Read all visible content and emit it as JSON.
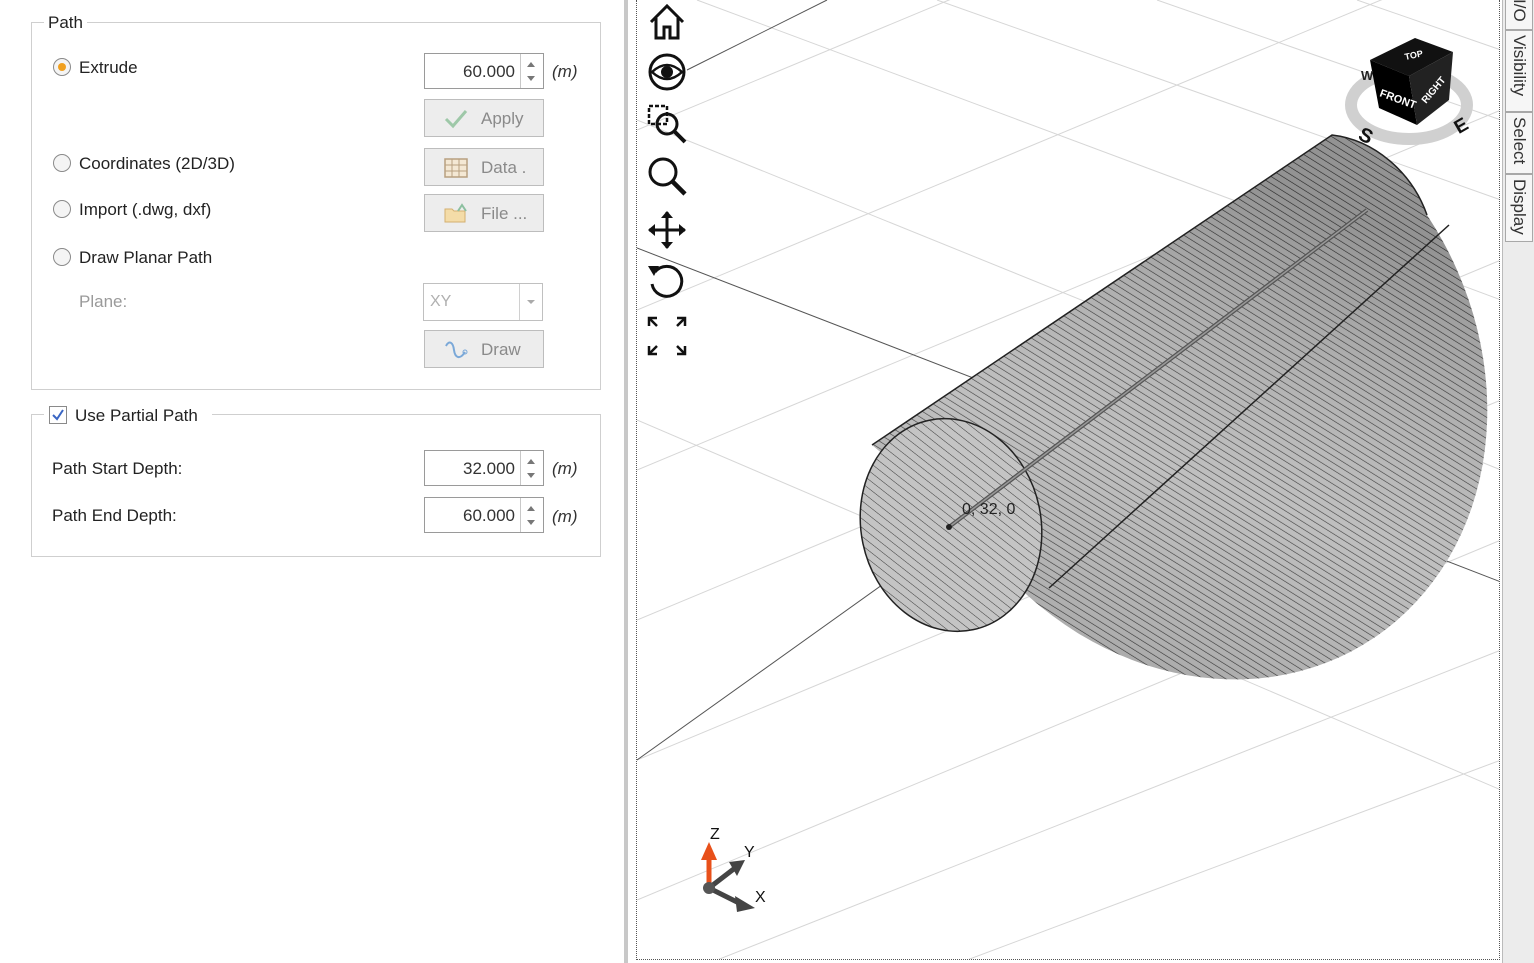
{
  "path": {
    "title": "Path",
    "extrude_label": "Extrude",
    "extrude_value": "60.000",
    "unit": "(m)",
    "apply_label": "Apply",
    "coordinates_label": "Coordinates (2D/3D)",
    "data_label": "Data .",
    "import_label": "Import (.dwg, dxf)",
    "file_label": "File ...",
    "draw_planar_label": "Draw Planar Path",
    "plane_label": "Plane:",
    "plane_value": "XY",
    "draw_label": "Draw",
    "selected": "Extrude"
  },
  "partial": {
    "title": "Use Partial Path",
    "checked": true,
    "start_label": "Path Start Depth:",
    "start_value": "32.000",
    "end_label": "Path End Depth:",
    "end_value": "60.000",
    "unit": "(m)"
  },
  "viewport": {
    "point_label": "0, 32, 0",
    "axis_z": "Z",
    "axis_y": "Y",
    "axis_x": "X",
    "cube_top": "TOP",
    "cube_front": "FRONT",
    "cube_right": "RIGHT",
    "compass_s": "S",
    "compass_e": "E",
    "compass_w": "W"
  },
  "tabs": [
    "I/O",
    "Visibility",
    "Select",
    "Display"
  ],
  "colors": {
    "radio_selected": "#f0a020",
    "z_axis": "#e8501a",
    "check": "#3a66c4"
  }
}
